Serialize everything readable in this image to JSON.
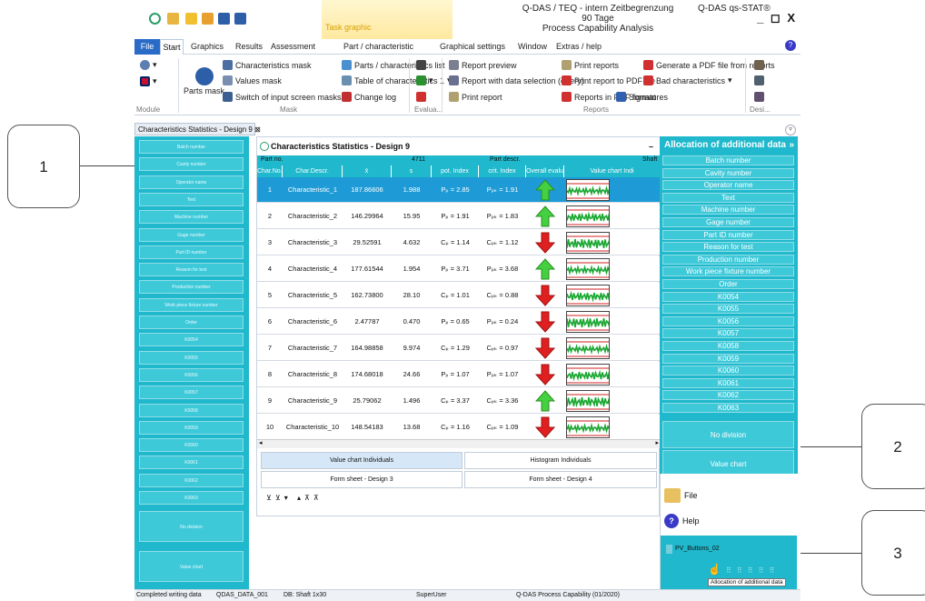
{
  "app": {
    "title_line1": "Q-DAS / TEQ - intern Zeitbegrenzung 90 Tage",
    "title_line2": "Process Capability Analysis",
    "product": "Q-DAS qs-STAT®",
    "task": "Task graphic",
    "window_buttons": "_ ◻ X"
  },
  "menu": {
    "file": "File",
    "start": "Start",
    "graphics": "Graphics",
    "results": "Results",
    "assessment": "Assessment",
    "part_char": "Part / characteristic",
    "graph_settings": "Graphical settings",
    "window": "Window",
    "extras": "Extras / help"
  },
  "ribbon": {
    "parts_mask": "Parts mask",
    "char_mask": "Characteristics mask",
    "values_mask": "Values mask",
    "switch_masks": "Switch of input screen masks",
    "parts_list": "Parts / characteristics list",
    "table_chars": "Table of characteristics 1",
    "change_log": "Change log",
    "report_preview": "Report preview",
    "report_query": "Report with data selection (query)",
    "print_report": "Print report",
    "print_reports": "Print reports",
    "print_pdf": "Print report to PDF file",
    "reports_pdf": "Reports in PDF format",
    "gen_pdf": "Generate a PDF file from reports",
    "bad_chars": "Bad characteristics",
    "signatures": "Signatures",
    "grp_module": "Module",
    "grp_mask": "Mask",
    "grp_eval": "Evalua...",
    "grp_reports": "Reports",
    "grp_desi": "Desi..."
  },
  "doc_tab": "Characteristics Statistics - Design 9",
  "left_buttons": [
    "Batch number",
    "Cavity number",
    "Operator name",
    "Text",
    "Machine number",
    "Gage number",
    "Part ID number",
    "Reason for test",
    "Production number",
    "Work piece fixture number",
    "Order",
    "K0054",
    "K0055",
    "K0056",
    "K0057",
    "K0058",
    "K0059",
    "K0060",
    "K0061",
    "K0062",
    "K0063"
  ],
  "left_big": [
    "No division",
    "Value chart"
  ],
  "table": {
    "title": "Characteristics Statistics - Design 9",
    "part_no_label": "Part no.",
    "part_no": "4711",
    "part_descr_label": "Part descr.",
    "part_descr": "Shaft",
    "headers": [
      "Char.No.",
      "Char.Descr.",
      "x̄",
      "s",
      "pot. Index",
      "crit. Index",
      "Overall evalu",
      "Value chart Indi"
    ],
    "rows": [
      {
        "no": "1",
        "descr": "Characteristic_1",
        "mean": "187.86606",
        "s": "1.988",
        "pot": "Pₚ  =  2.85",
        "crit": "Pₚₖ  =  1.91",
        "ok": true
      },
      {
        "no": "2",
        "descr": "Characteristic_2",
        "mean": "146.29964",
        "s": "15.95",
        "pot": "Pₚ  =  1.91",
        "crit": "Pₚₖ  =  1.83",
        "ok": true
      },
      {
        "no": "3",
        "descr": "Characteristic_3",
        "mean": "29.52591",
        "s": "4.632",
        "pot": "Cₚ  =  1.14",
        "crit": "Cₚₖ  =  1.12",
        "ok": false
      },
      {
        "no": "4",
        "descr": "Characteristic_4",
        "mean": "177.61544",
        "s": "1.954",
        "pot": "Pₚ  =  3.71",
        "crit": "Pₚₖ  =  3.68",
        "ok": true
      },
      {
        "no": "5",
        "descr": "Characteristic_5",
        "mean": "162.73800",
        "s": "28.10",
        "pot": "Cₚ  =  1.01",
        "crit": "Cₚₖ  =  0.88",
        "ok": false
      },
      {
        "no": "6",
        "descr": "Characteristic_6",
        "mean": "2.47787",
        "s": "0.470",
        "pot": "Pₚ  =  0.65",
        "crit": "Pₚₖ  =  0.24",
        "ok": false
      },
      {
        "no": "7",
        "descr": "Characteristic_7",
        "mean": "164.98858",
        "s": "9.974",
        "pot": "Cₚ  =  1.29",
        "crit": "Cₚₖ  =  0.97",
        "ok": false
      },
      {
        "no": "8",
        "descr": "Characteristic_8",
        "mean": "174.68018",
        "s": "24.66",
        "pot": "Pₚ  =  1.07",
        "crit": "Pₚₖ  =  1.07",
        "ok": false
      },
      {
        "no": "9",
        "descr": "Characteristic_9",
        "mean": "25.79062",
        "s": "1.496",
        "pot": "Cₚ  =  3.37",
        "crit": "Cₚₖ  =  3.36",
        "ok": true
      },
      {
        "no": "10",
        "descr": "Characteristic_10",
        "mean": "148.54183",
        "s": "13.68",
        "pot": "Cₚ  =  1.16",
        "crit": "Cₚₖ  =  1.09",
        "ok": false
      }
    ]
  },
  "bottom_buttons": [
    "Value chart Individuals",
    "Histogram Individuals",
    "Form sheet - Design 3",
    "Form sheet - Design 4"
  ],
  "right_panel": {
    "title": "Allocation of additional data",
    "expand": "»",
    "buttons": [
      "Batch number",
      "Cavity number",
      "Operator name",
      "Text",
      "Machine number",
      "Gage number",
      "Part ID number",
      "Reason for test",
      "Production number",
      "Work piece fixture number",
      "Order",
      "K0054",
      "K0055",
      "K0056",
      "K0057",
      "K0058",
      "K0059",
      "K0060",
      "K0061",
      "K0062",
      "K0063"
    ],
    "big": [
      "No division",
      "Value chart"
    ]
  },
  "lower_right": {
    "file": "File",
    "help": "Help",
    "pv_buttons": "PV_Buttons_02",
    "tooltip": "Allocation of additional data"
  },
  "status": {
    "s1": "Completed writing data",
    "s2": "QDAS_DATA_001",
    "s3": "DB: Shaft 1x30",
    "s4": "SuperUser",
    "s5": "Q-DAS Process Capability (01/2020)"
  },
  "callouts": [
    "1",
    "2",
    "3"
  ]
}
